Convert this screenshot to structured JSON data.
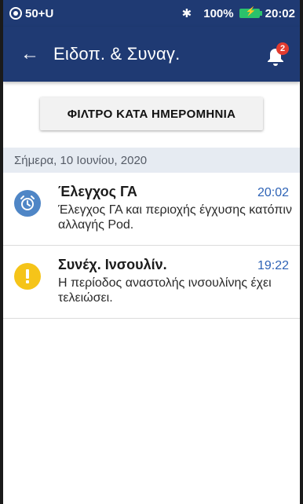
{
  "status_bar": {
    "pod_text": "50+U",
    "battery": "100%",
    "time": "20:02",
    "icons": [
      "pod-icon",
      "bluetooth-icon",
      "battery-charging-icon"
    ]
  },
  "header": {
    "title": "Ειδοπ. & Συναγ.",
    "notification_count": "2",
    "background_color": "#1f3a73",
    "badge_color": "#e23b2f"
  },
  "filter": {
    "button_label": "ΦΙΛΤΡΟ ΚΑΤΑ ΗΜΕΡΟΜΗΝΙΑ"
  },
  "groups": [
    {
      "date": "Σήμερα, 10 Ιουνίου, 2020",
      "items": [
        {
          "title": "Έλεγχος ΓΑ",
          "time": "20:02",
          "text": "Έλεγχος ΓΑ και περιοχής έγχυσης κατόπιν αλλαγής Pod.",
          "icon": "alarm-clock-icon",
          "icon_color": "#4f86c6"
        },
        {
          "title": "Συνέχ. Ινσουλίν.",
          "time": "19:22",
          "text": "Η περίοδος αναστολής ινσουλίνης έχει τελειώσει.",
          "icon": "exclamation-icon",
          "icon_color": "#f5c419"
        }
      ]
    }
  ]
}
